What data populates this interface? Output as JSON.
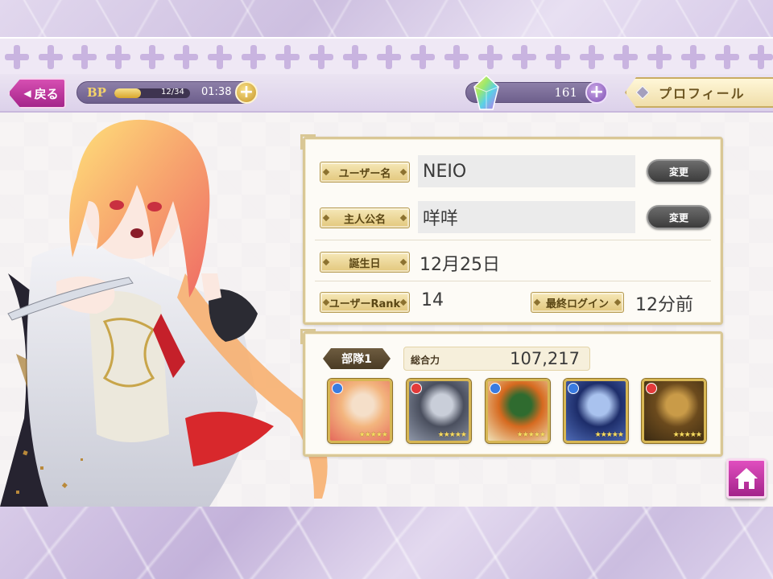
{
  "header": {
    "back_label": "戻る",
    "bp_label": "BP",
    "bp_count": "12/34",
    "bp_fraction": 0.35,
    "bp_timer": "01:38",
    "gem_count": "161",
    "profile_tab": "プロフィール"
  },
  "profile": {
    "username_label": "ユーザー名",
    "username_value": "NEIO",
    "protagonist_label": "主人公名",
    "protagonist_value": "咩咩",
    "birthday_label": "誕生日",
    "birthday_value": "12月25日",
    "rank_label": "ユーザーRank",
    "rank_value": "14",
    "last_login_label": "最終ログイン",
    "last_login_value": "12分前",
    "change_button": "変更"
  },
  "team": {
    "label": "部隊1",
    "power_label": "総合力",
    "power_value": "107,217",
    "members": [
      {
        "attribute": "blue",
        "stars": "★★★★★",
        "palette": [
          "#f3b57e",
          "#f5dfc9",
          "#e56a5c"
        ]
      },
      {
        "attribute": "red",
        "stars": "★★★★★",
        "palette": [
          "#4a4f5e",
          "#c9ced9",
          "#8f97a8"
        ]
      },
      {
        "attribute": "blue",
        "stars": "★★★★★",
        "palette": [
          "#d66a20",
          "#2f6b2f",
          "#efe0b6"
        ]
      },
      {
        "attribute": "blue",
        "stars": "★★★★★",
        "palette": [
          "#1d2d6a",
          "#a9c2ee",
          "#4f6bb5"
        ]
      },
      {
        "attribute": "red",
        "stars": "★★★★★",
        "palette": [
          "#6b4a1d",
          "#c99b48",
          "#3a2a12"
        ]
      }
    ]
  },
  "colors": {
    "accent_pink": "#b02a95",
    "gold": "#d9c795",
    "attr_blue": "#3a7be0",
    "attr_red": "#e23a3a"
  }
}
